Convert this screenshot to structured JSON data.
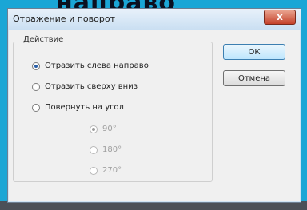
{
  "background": {
    "heading_fragment": "направо"
  },
  "dialog": {
    "title": "Отражение и поворот",
    "close_glyph": "x",
    "group_label": "Действие",
    "options": [
      "Отразить слева направо",
      "Отразить сверху вниз",
      "Повернуть на угол"
    ],
    "selected_option": "Отразить слева направо",
    "angles": [
      "90°",
      "180°",
      "270°"
    ],
    "selected_angle": "90°",
    "angles_enabled": false,
    "ok_label": "ОК",
    "cancel_label": "Отмена"
  }
}
